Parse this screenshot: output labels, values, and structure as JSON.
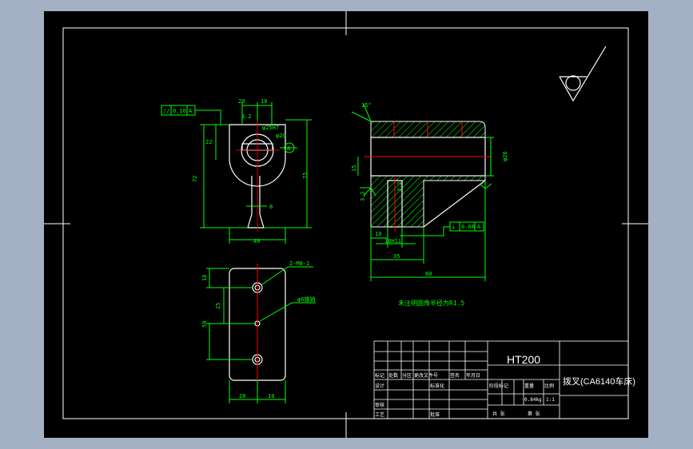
{
  "drawing": {
    "material": "HT200",
    "title": "拨叉(CA6140车床)",
    "scale": "1:1",
    "weight": "0.84kg",
    "note": "未注明圆角半径为R1.5",
    "colors": {
      "background": "#000000",
      "frame": "#ffffff",
      "part": "#ffffff",
      "dimension": "#00ff00",
      "centerline": "#ff0000",
      "hatch": "#00ff00",
      "outer": "#a4b0c4"
    }
  },
  "front_view": {
    "dims": {
      "top_left": "20",
      "top_right": "10",
      "width": "40",
      "height_left": "72",
      "height_right": "75",
      "stem": "8",
      "upper": "22",
      "angle": "3.2"
    },
    "tolerance_frame": [
      "//",
      "0.10",
      "A"
    ],
    "callouts": [
      "φ25H7",
      "φ20",
      "A"
    ]
  },
  "side_view": {
    "dims": {
      "angle": "15°",
      "diameter": "φ26",
      "left": "15",
      "bottom_10": "10",
      "hole": "18H11",
      "d35": "35",
      "d80": "80",
      "rough_left": "3.2",
      "rough_mid": "3.2"
    },
    "tolerance_frame": [
      "⊥",
      "0.08",
      "A"
    ]
  },
  "bottom_view": {
    "dims": {
      "d16": "16",
      "d25": "25",
      "d50": "50",
      "w20": "20",
      "w10": "10"
    },
    "callouts": [
      "2-M8-1",
      "φ6锥销"
    ]
  },
  "title_block": {
    "row_labels": [
      "标记",
      "处数",
      "分区",
      "更改文件号",
      "签名",
      "年月日"
    ],
    "design": "设计",
    "standard": "标准化",
    "check": "审核",
    "process": "工艺",
    "approve": "批准",
    "stage": "阶段标记",
    "weight_label": "重量",
    "scale_label": "比例",
    "sheet_total": "共  张",
    "sheet_num": "第  张"
  }
}
